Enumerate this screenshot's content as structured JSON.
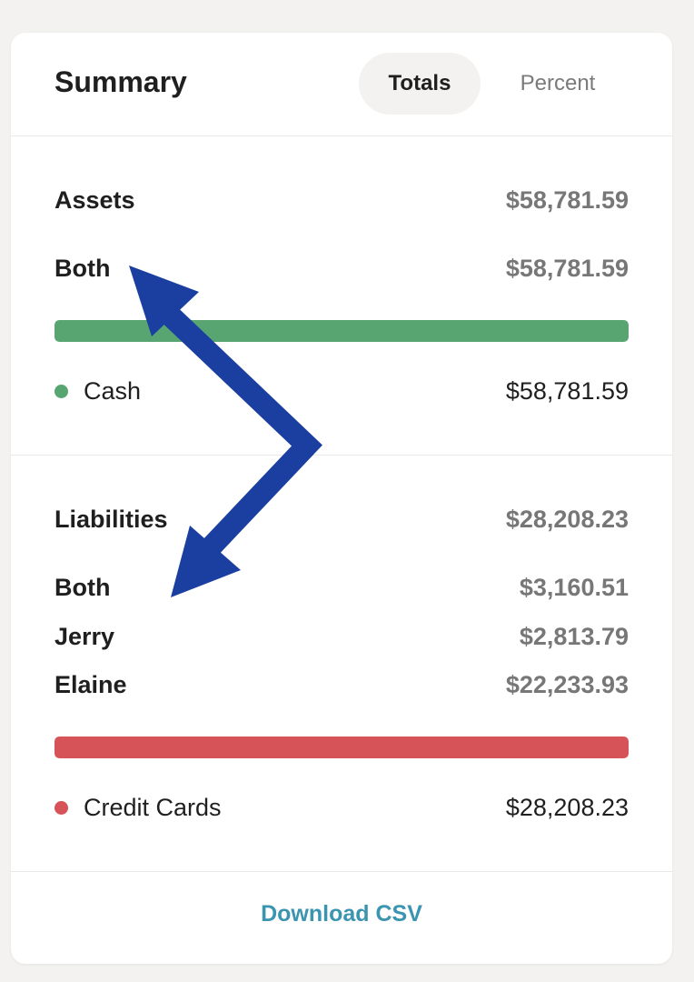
{
  "header": {
    "title": "Summary",
    "tabs": [
      {
        "label": "Totals",
        "active": true
      },
      {
        "label": "Percent",
        "active": false
      }
    ]
  },
  "assets": {
    "label": "Assets",
    "total": "$58,781.59",
    "owners": [
      {
        "label": "Both",
        "value": "$58,781.59"
      }
    ],
    "bar": {
      "color": "#58a572",
      "fill_fraction": 1.0
    },
    "categories": [
      {
        "label": "Cash",
        "value": "$58,781.59",
        "color": "#58a572"
      }
    ]
  },
  "liabilities": {
    "label": "Liabilities",
    "total": "$28,208.23",
    "owners": [
      {
        "label": "Both",
        "value": "$3,160.51"
      },
      {
        "label": "Jerry",
        "value": "$2,813.79"
      },
      {
        "label": "Elaine",
        "value": "$22,233.93"
      }
    ],
    "bar": {
      "color": "#d65457",
      "fill_fraction": 1.0
    },
    "categories": [
      {
        "label": "Credit Cards",
        "value": "$28,208.23",
        "color": "#d65457"
      }
    ]
  },
  "footer": {
    "download_label": "Download CSV"
  },
  "annotation": {
    "arrow_color": "#1a3fa0",
    "arrow_count": 2
  }
}
